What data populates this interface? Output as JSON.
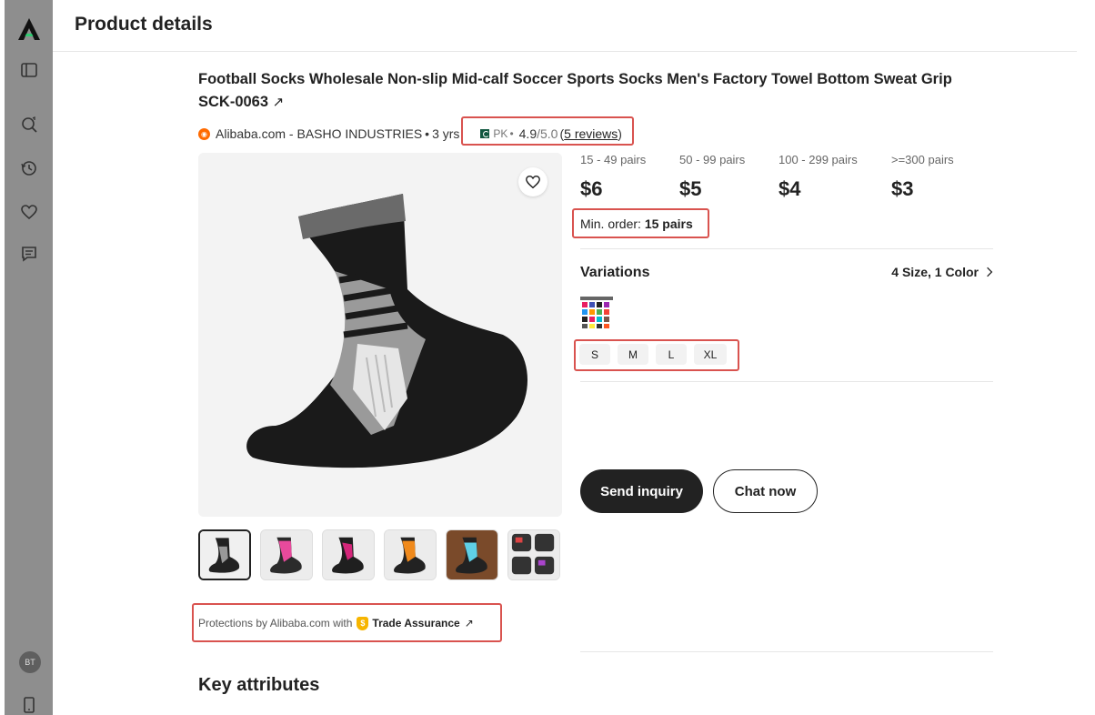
{
  "header": {
    "title": "Product details"
  },
  "sidebar": {
    "avatar_initials": "BT",
    "icons": [
      "logo-icon",
      "sidebar-toggle-icon",
      "search-refresh-icon",
      "history-icon",
      "heart-icon",
      "chat-icon",
      "mobile-icon"
    ]
  },
  "product": {
    "title": "Football Socks Wholesale Non-slip Mid-calf Soccer Sports Socks Men's Factory Towel Bottom Sweat Grip SCK-0063",
    "title_link_glyph": "↗",
    "seller": "Alibaba.com - BASHO INDUSTRIES",
    "separator": "•",
    "years": "3 yrs",
    "country": "PK",
    "rating": "4.9",
    "rating_max": "/5.0",
    "reviews_open": "(",
    "reviews": "5 reviews",
    "reviews_close": ")"
  },
  "pricing": {
    "tiers": [
      {
        "qty": "15 - 49 pairs",
        "price": "$6"
      },
      {
        "qty": "50 - 99 pairs",
        "price": "$5"
      },
      {
        "qty": "100 - 299 pairs",
        "price": "$4"
      },
      {
        "qty": ">=300 pairs",
        "price": "$3"
      }
    ],
    "min_order_label": "Min. order:",
    "min_order_value": "15 pairs"
  },
  "variations": {
    "label": "Variations",
    "summary": "4 Size, 1 Color",
    "sizes": [
      "S",
      "M",
      "L",
      "XL"
    ]
  },
  "actions": {
    "primary": "Send inquiry",
    "secondary": "Chat now"
  },
  "protection": {
    "prefix": "Protections by Alibaba.com with",
    "badge": "Trade Assurance",
    "glyph": "↗"
  },
  "sections": {
    "key_attributes": "Key attributes"
  },
  "colors": {
    "accent_dark": "#222222",
    "highlight_red": "#d9534f",
    "sidebar": "#8e8e8e",
    "alibaba_orange": "#ff6a00"
  }
}
